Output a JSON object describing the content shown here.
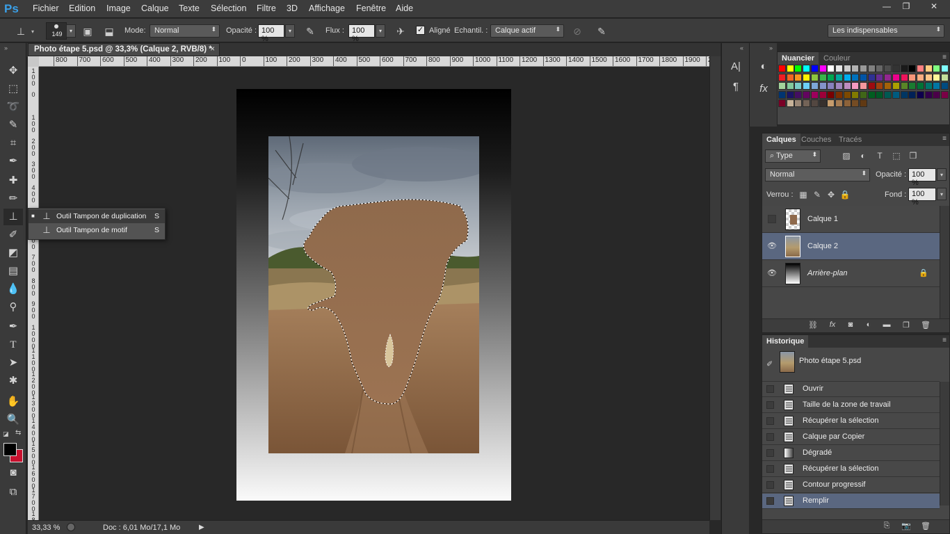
{
  "app": {
    "logo": "Ps"
  },
  "menu": [
    "Fichier",
    "Edition",
    "Image",
    "Calque",
    "Texte",
    "Sélection",
    "Filtre",
    "3D",
    "Affichage",
    "Fenêtre",
    "Aide"
  ],
  "window_controls": {
    "minimize": "—",
    "restore": "❐",
    "close": "✕"
  },
  "options": {
    "brush_size": "149",
    "mode_label": "Mode:",
    "mode_value": "Normal",
    "opacity_label": "Opacité :",
    "opacity_value": "100 %",
    "flow_label": "Flux :",
    "flow_value": "100 %",
    "aligned_label": "Aligné",
    "aligned_checked": "✓",
    "sample_label": "Echantil. :",
    "sample_value": "Calque actif",
    "workspace_value": "Les indispensables"
  },
  "document": {
    "tab_title": "Photo étape 5.psd @ 33,3% (Calque 2, RVB/8) *",
    "tab_close": "×",
    "ruler_h": [
      "800",
      "700",
      "600",
      "500",
      "400",
      "300",
      "200",
      "100",
      "0",
      "100",
      "200",
      "300",
      "400",
      "500",
      "600",
      "700",
      "800",
      "900",
      "1000",
      "1100",
      "1200",
      "1300",
      "1400",
      "1500",
      "1600",
      "1700",
      "1800",
      "1900",
      "20"
    ],
    "ruler_v": [
      "1\n0\n0",
      "0",
      "1\n0\n0",
      "2\n0\n0",
      "3\n0\n0",
      "4\n0\n0",
      "5\n0\n0",
      "6\n0\n0",
      "7\n0\n0",
      "8\n0\n0",
      "9\n0\n0",
      "1\n0\n0\n0",
      "1\n1\n0\n0",
      "1\n2\n0\n0",
      "1\n3\n0\n0",
      "1\n4\n0\n0",
      "1\n5\n0\n0",
      "1\n6\n0\n0",
      "1\n7\n0\n0",
      "1\n8\n0\n0"
    ]
  },
  "status": {
    "zoom": "33,33 %",
    "doc_info": "Doc : 6,01 Mo/17,1 Mo"
  },
  "flyout": [
    {
      "label": "Outil Tampon de duplication",
      "key": "S"
    },
    {
      "label": "Outil Tampon de motif",
      "key": "S"
    }
  ],
  "swatches_panel": {
    "tabs": [
      "Nuancier",
      "Couleur"
    ],
    "colors": [
      "#ff0000",
      "#ffff00",
      "#00ff00",
      "#00ffff",
      "#0000ff",
      "#ff00ff",
      "#ffffff",
      "#e6e6e6",
      "#cccccc",
      "#b3b3b3",
      "#999999",
      "#808080",
      "#666666",
      "#4d4d4d",
      "#333333",
      "#1a1a1a",
      "#000000",
      "#ff8080",
      "#ffcc80",
      "#80ff80",
      "#80ffff",
      "#ee1d24",
      "#f26522",
      "#f7941d",
      "#fff200",
      "#8dc63f",
      "#39b54a",
      "#00a651",
      "#00a99d",
      "#00aeef",
      "#0072bc",
      "#0054a6",
      "#2e3192",
      "#662d91",
      "#92278f",
      "#ec008c",
      "#ed145b",
      "#f69679",
      "#f9ad81",
      "#fdc689",
      "#fff799",
      "#c4df9b",
      "#a3d39c",
      "#82ca9c",
      "#7accc8",
      "#6dcff6",
      "#7da7d9",
      "#8393ca",
      "#8781bd",
      "#a187be",
      "#bd8cbf",
      "#f49ac1",
      "#f5989d",
      "#9e0b0f",
      "#a0410d",
      "#a36209",
      "#aba000",
      "#598527",
      "#1a7b30",
      "#007236",
      "#00746b",
      "#0076a3",
      "#004b80",
      "#003471",
      "#1b1464",
      "#440e62",
      "#630460",
      "#9e005d",
      "#9e0039",
      "#790000",
      "#7b2e00",
      "#7d4900",
      "#827b00",
      "#406618",
      "#005e20",
      "#005826",
      "#005952",
      "#005b7f",
      "#003663",
      "#002157",
      "#0d004c",
      "#32004b",
      "#4b0049",
      "#7b0046",
      "#7a0026",
      "#c7b299",
      "#998675",
      "#736357",
      "#534741",
      "#37302d",
      "#c69c6d",
      "#a67c52",
      "#8c6239",
      "#754c24",
      "#603913"
    ]
  },
  "layers_panel": {
    "tabs": [
      "Calques",
      "Couches",
      "Tracés"
    ],
    "filter_value": "Type",
    "blend_value": "Normal",
    "opacity_label": "Opacité :",
    "opacity_value": "100 %",
    "lock_label": "Verrou :",
    "fill_label": "Fond :",
    "fill_value": "100 %",
    "layers": [
      {
        "name": "Calque 1",
        "visible": false,
        "selected": false
      },
      {
        "name": "Calque 2",
        "visible": true,
        "selected": true
      },
      {
        "name": "Arrière-plan",
        "visible": true,
        "selected": false,
        "locked": true
      }
    ]
  },
  "history_panel": {
    "tab": "Historique",
    "snapshot": "Photo étape 5.psd",
    "items": [
      "Ouvrir",
      "Taille de la zone de travail",
      "Récupérer la sélection",
      "Calque par Copier",
      "Dégradé",
      "Récupérer la sélection",
      "Contour progressif",
      "Remplir"
    ],
    "selected_index": 7
  },
  "colors": {
    "foreground": "#000000",
    "background": "#c8102e",
    "selection_blue": "#5a6780"
  }
}
